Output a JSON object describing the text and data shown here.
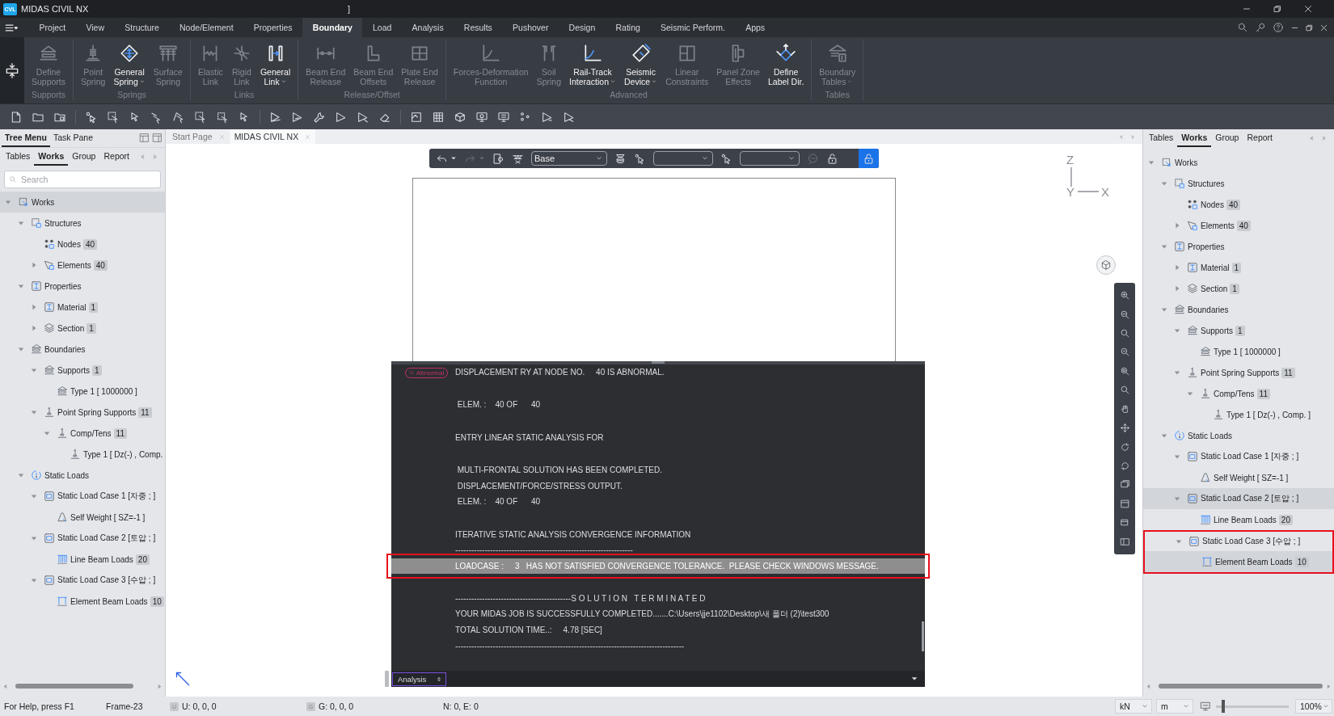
{
  "title_bar": {
    "logo": "CVL",
    "title": "MIDAS CIVIL NX",
    "fragment": "]"
  },
  "menu_tabs": [
    {
      "label": "Project",
      "selected": false
    },
    {
      "label": "View",
      "selected": false
    },
    {
      "label": "Structure",
      "selected": false
    },
    {
      "label": "Node/Element",
      "selected": false
    },
    {
      "label": "Properties",
      "selected": false
    },
    {
      "label": "Boundary",
      "selected": true
    },
    {
      "label": "Load",
      "selected": false
    },
    {
      "label": "Analysis",
      "selected": false
    },
    {
      "label": "Results",
      "selected": false
    },
    {
      "label": "Pushover",
      "selected": false
    },
    {
      "label": "Design",
      "selected": false
    },
    {
      "label": "Rating",
      "selected": false
    },
    {
      "label": "Seismic Perform.",
      "selected": false
    },
    {
      "label": "Apps",
      "selected": false
    }
  ],
  "ribbon": {
    "groups": [
      {
        "title": "Supports",
        "buttons": [
          {
            "lines": [
              "Define",
              "Supports"
            ],
            "kind": "support",
            "disabled": true,
            "dropdown": false
          }
        ]
      },
      {
        "title": "Springs",
        "buttons": [
          {
            "lines": [
              "Point",
              "Spring"
            ],
            "kind": "spring",
            "disabled": true,
            "dropdown": false
          },
          {
            "lines": [
              "General",
              "Spring"
            ],
            "kind": "spring-cross",
            "disabled": false,
            "dropdown": true
          },
          {
            "lines": [
              "Surface",
              "Spring"
            ],
            "kind": "surface-spring",
            "disabled": true,
            "dropdown": false
          }
        ]
      },
      {
        "title": "Links",
        "buttons": [
          {
            "lines": [
              "Elastic",
              "Link"
            ],
            "kind": "elastic-link",
            "disabled": true,
            "dropdown": false
          },
          {
            "lines": [
              "Rigid",
              "Link"
            ],
            "kind": "rigid-link",
            "disabled": true,
            "dropdown": false
          },
          {
            "lines": [
              "General",
              "Link"
            ],
            "kind": "general-link",
            "disabled": false,
            "dropdown": true
          }
        ]
      },
      {
        "title": "Release/Offset",
        "buttons": [
          {
            "lines": [
              "Beam End",
              "Release"
            ],
            "kind": "release",
            "disabled": true,
            "dropdown": false
          },
          {
            "lines": [
              "Beam End",
              "Offsets"
            ],
            "kind": "offset",
            "disabled": true,
            "dropdown": false
          },
          {
            "lines": [
              "Plate End",
              "Release"
            ],
            "kind": "plate",
            "disabled": true,
            "dropdown": false
          }
        ]
      },
      {
        "title": "Advanced",
        "buttons": [
          {
            "lines": [
              "Forces-Deformation",
              "Function"
            ],
            "kind": "curve",
            "disabled": true,
            "dropdown": false
          },
          {
            "lines": [
              "Soil",
              "Spring"
            ],
            "kind": "soil",
            "disabled": true,
            "dropdown": false
          },
          {
            "lines": [
              "Rail-Track",
              "Interaction"
            ],
            "kind": "rail",
            "disabled": false,
            "dropdown": true
          },
          {
            "lines": [
              "Seismic",
              "Device"
            ],
            "kind": "seismic",
            "disabled": false,
            "dropdown": true
          },
          {
            "lines": [
              "Linear",
              "Constraints"
            ],
            "kind": "constraints",
            "disabled": true,
            "dropdown": false
          },
          {
            "lines": [
              "Panel Zone",
              "Effects"
            ],
            "kind": "panel",
            "disabled": true,
            "dropdown": false
          },
          {
            "lines": [
              "Define",
              "Label Dir."
            ],
            "kind": "label-dir",
            "disabled": false,
            "dropdown": false
          }
        ]
      },
      {
        "title": "Tables",
        "buttons": [
          {
            "lines": [
              "Boundary",
              "Tables"
            ],
            "kind": "table",
            "disabled": true,
            "dropdown": true
          }
        ]
      }
    ]
  },
  "left_panel": {
    "tabs": [
      {
        "label": "Tree Menu",
        "selected": true
      },
      {
        "label": "Task Pane",
        "selected": false
      }
    ],
    "subtabs": [
      {
        "label": "Tables",
        "selected": false
      },
      {
        "label": "Works",
        "selected": true
      },
      {
        "label": "Group",
        "selected": false
      },
      {
        "label": "Report",
        "selected": false
      }
    ],
    "search": {
      "placeholder": "Search"
    },
    "tree": [
      {
        "label": "Works",
        "kind": "works",
        "expanded": true,
        "selected": true,
        "outlined": false,
        "children": [
          {
            "label": "Structures",
            "kind": "structures",
            "expanded": true,
            "selected": false,
            "outlined": false,
            "children": [
              {
                "label": "Nodes",
                "count": "40",
                "kind": "nodes",
                "selected": false,
                "outlined": false
              },
              {
                "label": "Elements",
                "count": "40",
                "kind": "elements",
                "expanded": false,
                "selected": false,
                "outlined": false
              }
            ]
          },
          {
            "label": "Properties",
            "kind": "properties",
            "expanded": true,
            "selected": false,
            "outlined": false,
            "children": [
              {
                "label": "Material",
                "count": "1",
                "kind": "material",
                "expanded": false,
                "selected": false,
                "outlined": false
              },
              {
                "label": "Section",
                "count": "1",
                "kind": "section",
                "expanded": false,
                "selected": false,
                "outlined": false
              }
            ]
          },
          {
            "label": "Boundaries",
            "kind": "supports",
            "expanded": true,
            "selected": false,
            "outlined": false,
            "children": [
              {
                "label": "Supports",
                "count": "1",
                "kind": "supports",
                "expanded": true,
                "selected": false,
                "outlined": false,
                "children": [
                  {
                    "label": "Type 1 [ 1000000 ]",
                    "kind": "supports",
                    "selected": false,
                    "outlined": false
                  }
                ]
              },
              {
                "label": "Point Spring Supports",
                "count": "11",
                "kind": "spring",
                "expanded": true,
                "selected": false,
                "outlined": false,
                "children": [
                  {
                    "label": "Comp/Tens",
                    "count": "11",
                    "kind": "spring",
                    "expanded": true,
                    "selected": false,
                    "outlined": false,
                    "children": [
                      {
                        "label": "Type 1 [ Dz(-) , Comp.",
                        "kind": "spring",
                        "selected": false,
                        "outlined": false
                      }
                    ]
                  }
                ]
              }
            ]
          },
          {
            "label": "Static Loads",
            "kind": "loads",
            "expanded": true,
            "selected": false,
            "outlined": false,
            "children": [
              {
                "label": "Static Load Case 1 [자중 ; ]",
                "kind": "load-case",
                "expanded": true,
                "selected": false,
                "outlined": false,
                "children": [
                  {
                    "label": "Self Weight [ SZ=-1 ]",
                    "kind": "self-weight",
                    "selected": false,
                    "outlined": false
                  }
                ]
              },
              {
                "label": "Static Load Case 2 [토압 ; ]",
                "kind": "load-case",
                "expanded": true,
                "selected": false,
                "outlined": false,
                "children": [
                  {
                    "label": "Line Beam Loads",
                    "count": "20",
                    "kind": "line-load",
                    "selected": false,
                    "outlined": false
                  }
                ]
              },
              {
                "label": "Static Load Case 3 [수압 ; ]",
                "kind": "load-case",
                "expanded": true,
                "selected": false,
                "outlined": false,
                "children": [
                  {
                    "label": "Element Beam Loads",
                    "count": "10",
                    "kind": "element-load",
                    "selected": false,
                    "outlined": false
                  }
                ]
              }
            ]
          }
        ]
      }
    ]
  },
  "document_tabs": [
    {
      "label": "Start Page",
      "selected": false
    },
    {
      "label": "MIDAS CIVIL NX",
      "selected": true
    }
  ],
  "view_toolbar": {
    "undo_disabled": false,
    "redo_disabled": true,
    "layer": "Base",
    "lock_on": true
  },
  "axes": {
    "z": "Z",
    "y": "Y",
    "x": "X"
  },
  "output": {
    "blocks": [
      {
        "lines": [
          {
            "badge": "Abnormal",
            "text": "DISPLACEMENT RY AT NODE NO.     40 IS ABNORMAL.",
            "selected": false,
            "outlined": false
          }
        ]
      },
      {
        "lines": [
          {
            "text": " ELEM. :    40 OF      40",
            "selected": false,
            "outlined": false
          }
        ]
      },
      {
        "lines": [
          {
            "text": "ENTRY LINEAR STATIC ANALYSIS FOR",
            "selected": false,
            "outlined": false
          }
        ]
      },
      {
        "lines": [
          {
            "text": " MULTI-FRONTAL SOLUTION HAS BEEN COMPLETED.",
            "selected": false,
            "outlined": false
          },
          {
            "text": " DISPLACEMENT/FORCE/STRESS OUTPUT.",
            "selected": false,
            "outlined": false
          },
          {
            "text": " ELEM. :    40 OF      40",
            "selected": false,
            "outlined": false
          }
        ]
      },
      {
        "lines": [
          {
            "text": "ITERATIVE STATIC ANALYSIS CONVERGENCE INFORMATION",
            "selected": false,
            "outlined": false
          },
          {
            "text": "------------------------------------------------------------------",
            "selected": false,
            "outlined": false
          },
          {
            "text": "LOADCASE :     3   HAS NOT SATISFIED CONVERGENCE TOLERANCE.  PLEASE CHECK WINDOWS MESSAGE.",
            "selected": true,
            "outlined": true
          }
        ]
      },
      {
        "lines": [
          {
            "text": "-------------------------------------------S O L U T I O N   T E R M I N A T E D",
            "selected": false,
            "outlined": false
          },
          {
            "text": "YOUR MIDAS JOB IS SUCCESSFULLY COMPLETED.......C:\\Users\\jje1102\\Desktop\\새 폴더 (2)\\test300",
            "selected": false,
            "outlined": false
          },
          {
            "text": "TOTAL SOLUTION TIME..:     4.78 [SEC]",
            "selected": false,
            "outlined": false
          },
          {
            "text": "-------------------------------------------------------------------------------------",
            "selected": false,
            "outlined": false
          }
        ]
      }
    ],
    "channel": "Analysis"
  },
  "right_panel": {
    "subtabs": [
      {
        "label": "Tables",
        "selected": false
      },
      {
        "label": "Works",
        "selected": true
      },
      {
        "label": "Group",
        "selected": false
      },
      {
        "label": "Report",
        "selected": false
      }
    ],
    "tree": [
      {
        "label": "Works",
        "kind": "works",
        "expanded": true,
        "selected": false,
        "outlined": false,
        "children": [
          {
            "label": "Structures",
            "kind": "structures",
            "expanded": true,
            "selected": false,
            "outlined": false,
            "children": [
              {
                "label": "Nodes",
                "count": "40",
                "kind": "nodes",
                "selected": false,
                "outlined": false
              },
              {
                "label": "Elements",
                "count": "40",
                "kind": "elements",
                "expanded": false,
                "selected": false,
                "outlined": false
              }
            ]
          },
          {
            "label": "Properties",
            "kind": "properties",
            "expanded": true,
            "selected": false,
            "outlined": false,
            "children": [
              {
                "label": "Material",
                "count": "1",
                "kind": "material",
                "expanded": false,
                "selected": false,
                "outlined": false
              },
              {
                "label": "Section",
                "count": "1",
                "kind": "section",
                "expanded": false,
                "selected": false,
                "outlined": false
              }
            ]
          },
          {
            "label": "Boundaries",
            "kind": "supports",
            "expanded": true,
            "selected": false,
            "outlined": false,
            "children": [
              {
                "label": "Supports",
                "count": "1",
                "kind": "supports",
                "expanded": true,
                "selected": false,
                "outlined": false,
                "children": [
                  {
                    "label": "Type 1 [ 1000000 ]",
                    "kind": "supports",
                    "selected": false,
                    "outlined": false
                  }
                ]
              },
              {
                "label": "Point Spring Supports",
                "count": "11",
                "kind": "spring",
                "expanded": true,
                "selected": false,
                "outlined": false,
                "children": [
                  {
                    "label": "Comp/Tens",
                    "count": "11",
                    "kind": "spring",
                    "expanded": true,
                    "selected": false,
                    "outlined": false,
                    "children": [
                      {
                        "label": "Type 1 [ Dz(-) , Comp. ]",
                        "kind": "spring",
                        "selected": false,
                        "outlined": false
                      }
                    ]
                  }
                ]
              }
            ]
          },
          {
            "label": "Static Loads",
            "kind": "loads",
            "expanded": true,
            "selected": false,
            "outlined": false,
            "children": [
              {
                "label": "Static Load Case 1 [자중 ; ]",
                "kind": "load-case",
                "expanded": true,
                "selected": false,
                "outlined": false,
                "children": [
                  {
                    "label": "Self Weight [ SZ=-1 ]",
                    "kind": "self-weight",
                    "selected": false,
                    "outlined": false
                  }
                ]
              },
              {
                "label": "Static Load Case 2 [토압 ; ]",
                "kind": "load-case",
                "expanded": true,
                "selected": true,
                "outlined": false,
                "children": [
                  {
                    "label": "Line Beam Loads",
                    "count": "20",
                    "kind": "line-load",
                    "selected": false,
                    "outlined": false
                  }
                ]
              },
              {
                "label": "Static Load Case 3 [수압 ; ]",
                "kind": "load-case",
                "expanded": true,
                "selected": false,
                "outlined": true,
                "children": [
                  {
                    "label": "Element Beam Loads",
                    "count": "10",
                    "kind": "element-load",
                    "selected": true,
                    "outlined": false
                  }
                ]
              }
            ]
          }
        ]
      }
    ]
  },
  "status_bar": {
    "help": "For Help, press F1",
    "frame": "Frame-23",
    "u_badge": "U",
    "u_coords": "U: 0, 0, 0",
    "g_badge": "G",
    "g_coords": "G: 0, 0, 0",
    "ne": "N: 0, E: 0",
    "force_unit": "kN",
    "length_unit": "m",
    "zoom_slider": {
      "level": 0.08
    },
    "zoom": "100%"
  }
}
